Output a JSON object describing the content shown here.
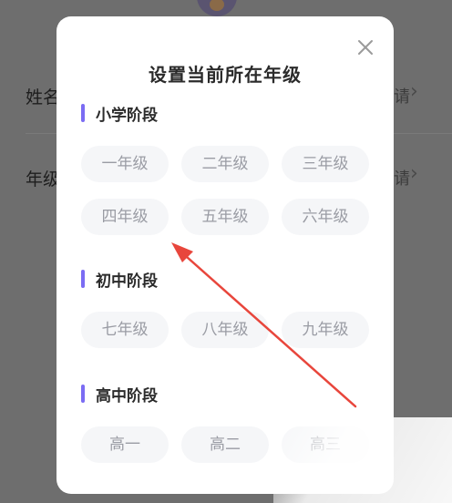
{
  "background": {
    "rows": [
      {
        "label": "姓名",
        "value": "请"
      },
      {
        "label": "年级",
        "value": "请"
      }
    ],
    "chevron": "›"
  },
  "modal": {
    "title": "设置当前所在年级",
    "close_icon": "close-icon",
    "sections": [
      {
        "label": "小学阶段",
        "grades": [
          "一年级",
          "二年级",
          "三年级",
          "四年级",
          "五年级",
          "六年级"
        ]
      },
      {
        "label": "初中阶段",
        "grades": [
          "七年级",
          "八年级",
          "九年级"
        ]
      },
      {
        "label": "高中阶段",
        "grades": [
          "高一",
          "高二",
          "高三"
        ]
      }
    ]
  },
  "colors": {
    "accent": "#7b6cf3",
    "overlay": "#6e6e6e",
    "button_bg": "#f5f6f8",
    "button_text": "#9a9ca4",
    "annotation": "#e8463c"
  }
}
